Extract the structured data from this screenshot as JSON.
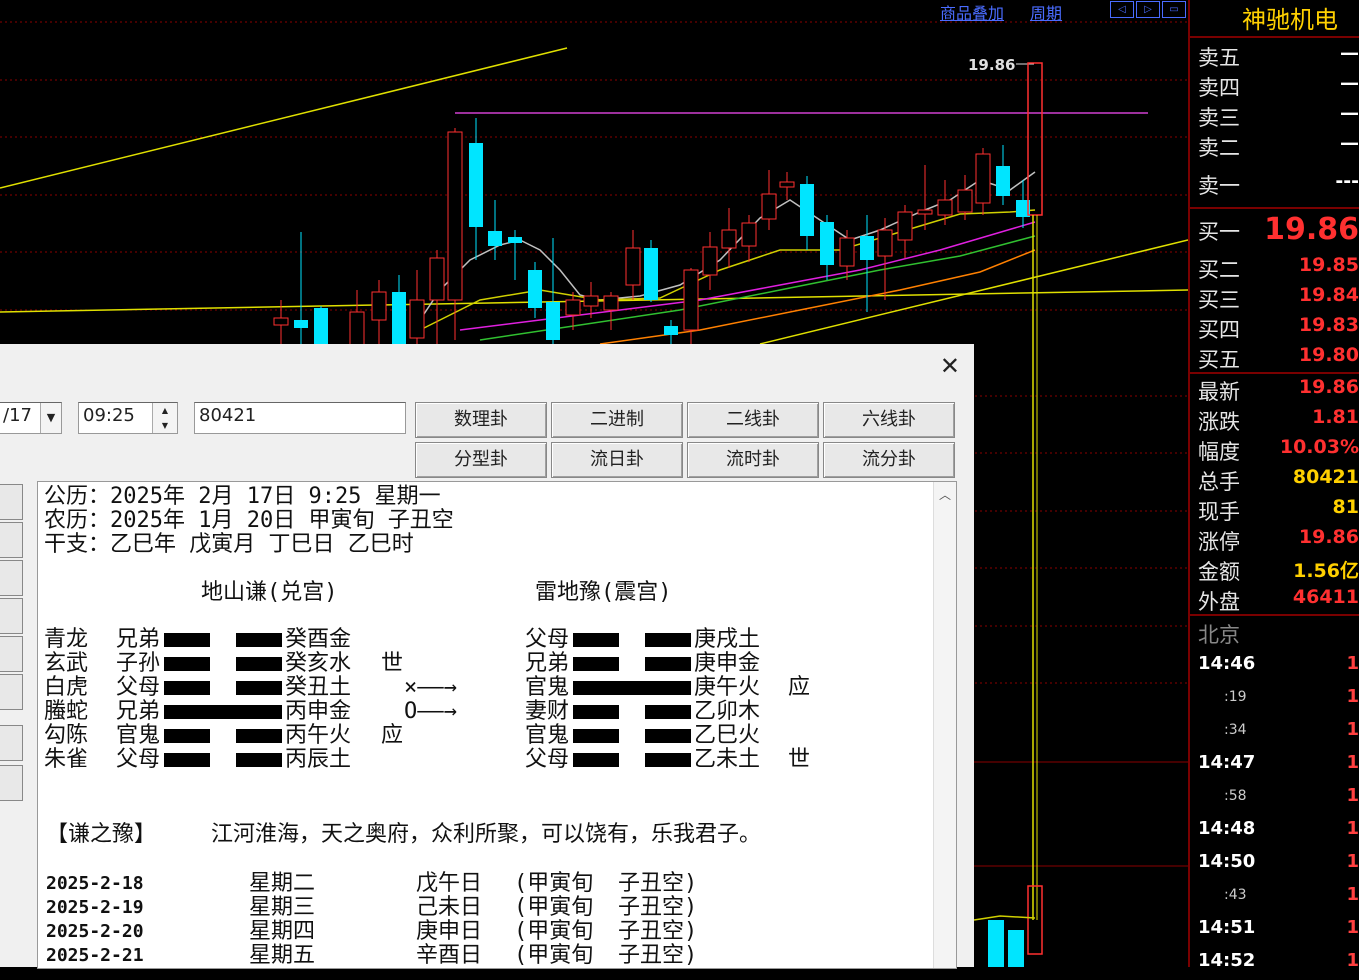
{
  "chart": {
    "links": [
      "商品叠加",
      "周期"
    ],
    "nav_buttons": [
      "◁",
      "▷",
      "▭"
    ],
    "high_label": "19.86"
  },
  "side": {
    "stock_name": "神驰机电",
    "sell": [
      {
        "label": "卖五",
        "value": "—"
      },
      {
        "label": "卖四",
        "value": "—"
      },
      {
        "label": "卖三",
        "value": "—"
      },
      {
        "label": "卖二",
        "value": "—"
      },
      {
        "label": "卖一",
        "value": "---"
      }
    ],
    "buy": [
      {
        "label": "买一",
        "value": "19.86"
      },
      {
        "label": "买二",
        "value": "19.85"
      },
      {
        "label": "买三",
        "value": "19.84"
      },
      {
        "label": "买四",
        "value": "19.83"
      },
      {
        "label": "买五",
        "value": "19.80"
      }
    ],
    "stats": [
      {
        "label": "最新",
        "value": "19.86",
        "color": "#ff3030"
      },
      {
        "label": "涨跌",
        "value": "1.81",
        "color": "#ff3030"
      },
      {
        "label": "幅度",
        "value": "10.03%",
        "color": "#ff3030"
      },
      {
        "label": "总手",
        "value": "80421",
        "color": "#ffd000"
      },
      {
        "label": "现手",
        "value": "81",
        "color": "#ffd000"
      },
      {
        "label": "涨停",
        "value": "19.86",
        "color": "#ff3030"
      },
      {
        "label": "金额",
        "value": "1.56亿",
        "color": "#ffd000"
      },
      {
        "label": "外盘",
        "value": "46411",
        "color": "#ff3030"
      }
    ],
    "region": "北京",
    "ticks": [
      {
        "time": "14:46",
        "sub": "",
        "val": "1"
      },
      {
        "time": "",
        "sub": ":19",
        "val": "1"
      },
      {
        "time": "",
        "sub": ":34",
        "val": "1"
      },
      {
        "time": "14:47",
        "sub": "",
        "val": "1"
      },
      {
        "time": "",
        "sub": ":58",
        "val": "1"
      },
      {
        "time": "14:48",
        "sub": "",
        "val": "1"
      },
      {
        "time": "14:50",
        "sub": "",
        "val": "1"
      },
      {
        "time": "",
        "sub": ":43",
        "val": "1"
      },
      {
        "time": "14:51",
        "sub": "",
        "val": "1"
      },
      {
        "time": "14:52",
        "sub": "",
        "val": "1"
      }
    ]
  },
  "dialog": {
    "date_value": "/17",
    "time_value": "09:25",
    "volume_value": "80421",
    "buttons_row1": [
      "数理卦",
      "二进制",
      "二线卦",
      "六线卦"
    ],
    "buttons_row2": [
      "分型卦",
      "流日卦",
      "流时卦",
      "流分卦"
    ],
    "text": {
      "line1": "公历：2025年 2月 17日 9:25 星期一",
      "line2": "农历：2025年 1月 20日 甲寅旬 子丑空",
      "line3": "干支：乙巳年 戊寅月 丁巳日 乙巳时",
      "hex1_title": "地山谦(兑宫)",
      "hex2_title": "雷地豫(震宫)",
      "hex1": [
        {
          "god": "青龙",
          "rel": "兄弟",
          "yin": true,
          "name": "癸酉金",
          "mark": ""
        },
        {
          "god": "玄武",
          "rel": "子孙",
          "yin": true,
          "name": "癸亥水",
          "mark": "世"
        },
        {
          "god": "白虎",
          "rel": "父母",
          "yin": true,
          "name": "癸丑土",
          "mark": ""
        },
        {
          "god": "螣蛇",
          "rel": "兄弟",
          "yin": false,
          "name": "丙申金",
          "mark": ""
        },
        {
          "god": "勾陈",
          "rel": "官鬼",
          "yin": true,
          "name": "丙午火",
          "mark": "应"
        },
        {
          "god": "朱雀",
          "rel": "父母",
          "yin": true,
          "name": "丙辰土",
          "mark": ""
        }
      ],
      "arrows": [
        "×——→",
        "O——→"
      ],
      "hex2": [
        {
          "rel": "父母",
          "yin": true,
          "name": "庚戌土",
          "mark": ""
        },
        {
          "rel": "兄弟",
          "yin": true,
          "name": "庚申金",
          "mark": ""
        },
        {
          "rel": "官鬼",
          "yin": false,
          "name": "庚午火",
          "mark": "应"
        },
        {
          "rel": "妻财",
          "yin": true,
          "name": "乙卯木",
          "mark": ""
        },
        {
          "rel": "官鬼",
          "yin": true,
          "name": "乙巳火",
          "mark": ""
        },
        {
          "rel": "父母",
          "yin": true,
          "name": "乙未土",
          "mark": "世"
        }
      ],
      "judgement_title": "【谦之豫】",
      "judgement": "江河淮海，天之奥府，众利所聚，可以饶有，乐我君子。",
      "days": [
        {
          "date": "2025-2-18",
          "week": "星期二",
          "day": "戊午日",
          "xun": "(甲寅旬",
          "kong": "子丑空)"
        },
        {
          "date": "2025-2-19",
          "week": "星期三",
          "day": "己未日",
          "xun": "(甲寅旬",
          "kong": "子丑空)"
        },
        {
          "date": "2025-2-20",
          "week": "星期四",
          "day": "庚申日",
          "xun": "(甲寅旬",
          "kong": "子丑空)"
        },
        {
          "date": "2025-2-21",
          "week": "星期五",
          "day": "辛酉日",
          "xun": "(甲寅旬",
          "kong": "子丑空)"
        }
      ]
    }
  }
}
